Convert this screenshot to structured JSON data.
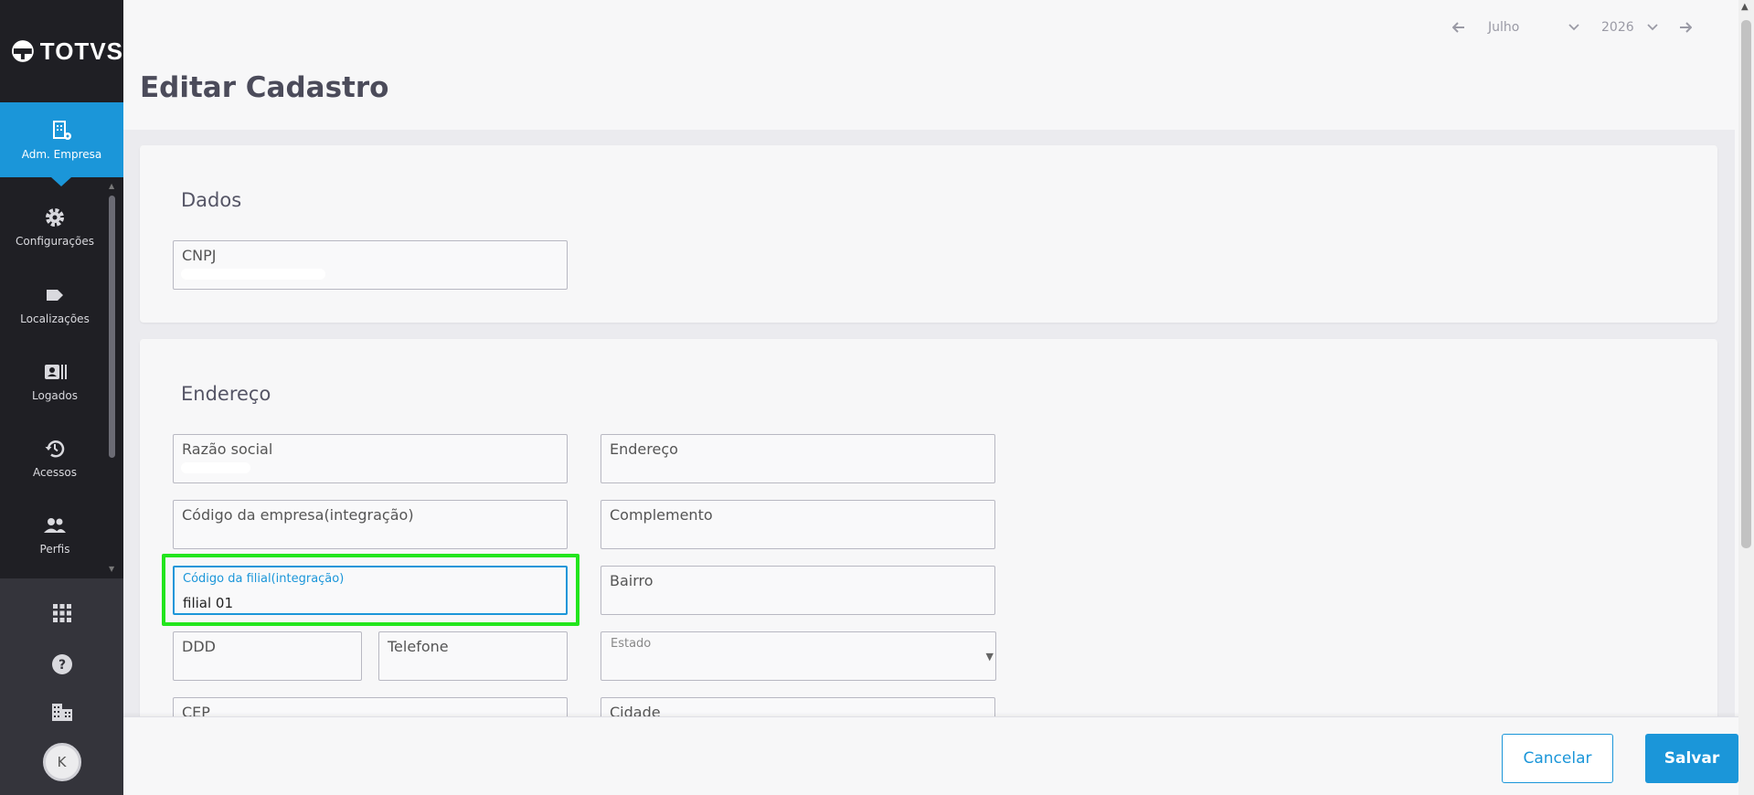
{
  "brand": {
    "name": "TOTVS"
  },
  "sidebar": {
    "items": [
      {
        "label": "Adm. Empresa",
        "icon": "building-gear-icon",
        "active": true
      },
      {
        "label": "Configurações",
        "icon": "gear-icon"
      },
      {
        "label": "Localizações",
        "icon": "tag-icon"
      },
      {
        "label": "Logados",
        "icon": "id-card-icon"
      },
      {
        "label": "Acessos",
        "icon": "history-icon"
      },
      {
        "label": "Perfis",
        "icon": "people-icon"
      }
    ],
    "bottom": {
      "apps_icon": "grid-icon",
      "help_icon": "help-icon",
      "company_icon": "building-icon",
      "avatar_initial": "K"
    }
  },
  "period": {
    "month": "Julho",
    "year": "2026"
  },
  "page": {
    "title": "Editar Cadastro"
  },
  "dados": {
    "title": "Dados",
    "cnpj_label": "CNPJ"
  },
  "endereco": {
    "title": "Endereço",
    "razao_social_label": "Razão social",
    "endereco_label": "Endereço",
    "codigo_empresa_label": "Código da empresa(integração)",
    "complemento_label": "Complemento",
    "codigo_filial_label": "Código da filial(integração)",
    "codigo_filial_value": "filial 01",
    "bairro_label": "Bairro",
    "ddd_label": "DDD",
    "telefone_label": "Telefone",
    "estado_label": "Estado",
    "cep_label": "CEP",
    "cidade_label": "Cidade"
  },
  "footer": {
    "cancel_label": "Cancelar",
    "save_label": "Salvar"
  },
  "colors": {
    "primary": "#1b96d9",
    "sidebar": "#1f1f24",
    "highlight": "#22e51d"
  }
}
